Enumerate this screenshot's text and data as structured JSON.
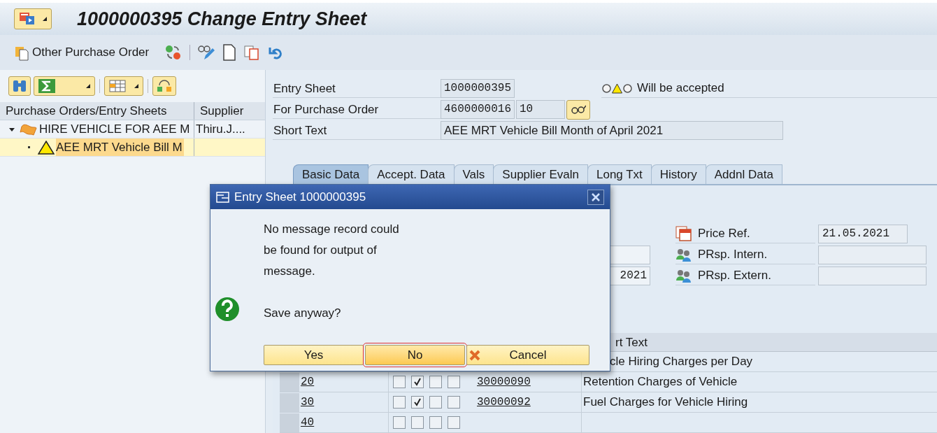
{
  "window": {
    "title": "1000000395 Change Entry Sheet"
  },
  "toolbar": {
    "button": "Other Purchase Order"
  },
  "tree": {
    "columns": [
      "Purchase Orders/Entry Sheets",
      "Supplier"
    ],
    "rows": [
      {
        "text": "HIRE VEHICLE FOR AEE M",
        "supplier": "Thiru.J....",
        "expanded": true,
        "selected": false,
        "children": [
          {
            "text": "AEE MRT Vehicle Bill M",
            "selected": true
          }
        ]
      }
    ]
  },
  "header": {
    "fields": [
      {
        "label": "Entry Sheet",
        "value": "1000000395"
      },
      {
        "label": "For Purchase Order",
        "value": "4600000016",
        "item": "10"
      },
      {
        "label": "Short Text",
        "value": "AEE MRT Vehicle Bill Month of April 2021"
      }
    ],
    "status": {
      "text": "Will be accepted",
      "lights_on": [
        false,
        true,
        false
      ]
    }
  },
  "tabs": [
    {
      "label": "Basic Data",
      "selected": true
    },
    {
      "label": "Accept. Data",
      "selected": false
    },
    {
      "label": "Vals",
      "selected": false
    },
    {
      "label": "Supplier Evaln",
      "selected": false
    },
    {
      "label": "Long Txt",
      "selected": false
    },
    {
      "label": "History",
      "selected": false
    },
    {
      "label": "Addnl Data",
      "selected": false
    }
  ],
  "basic_data": {
    "cut_field_value": "2021",
    "fields": [
      {
        "kind": "date",
        "label": "Price Ref.",
        "value": "21.05.2021"
      },
      {
        "kind": "person",
        "label": "PRsp. Intern."
      },
      {
        "kind": "person",
        "label": "PRsp. Extern."
      }
    ]
  },
  "services": {
    "short_text_header": "rt Text",
    "rows": [
      {
        "text": "cle Hiring Charges per Day"
      },
      {
        "line": "20",
        "checks": [
          false,
          true,
          false,
          false
        ],
        "service": "30000090",
        "text": "Retention Charges of Vehicle"
      },
      {
        "line": "30",
        "checks": [
          false,
          true,
          false,
          false
        ],
        "service": "30000092",
        "text": "Fuel Charges for Vehicle Hiring"
      },
      {
        "line": "40",
        "checks": [
          false,
          false,
          false,
          false
        ]
      }
    ]
  },
  "dialog": {
    "title": "Entry Sheet 1000000395",
    "message_lines": [
      "No message record could",
      "be found for output of",
      "message."
    ],
    "question": "Save anyway?",
    "buttons": [
      {
        "label": "Yes",
        "kind": "plain",
        "focused": false
      },
      {
        "label": "No",
        "kind": "plain",
        "focused": true
      },
      {
        "label": "Cancel",
        "kind": "cancel",
        "focused": false
      }
    ]
  }
}
